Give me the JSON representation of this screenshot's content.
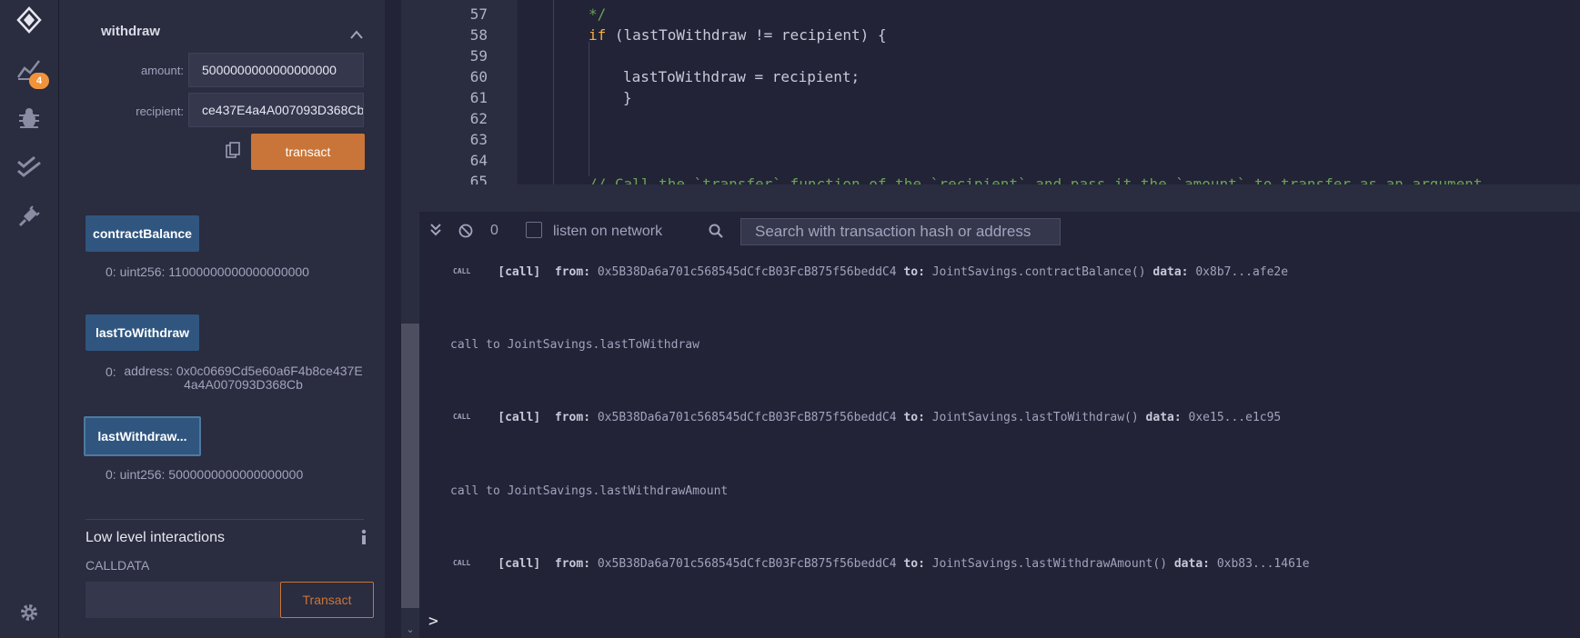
{
  "rail": {
    "badge_count": "4",
    "icons": [
      "remix-logo-icon",
      "deploy-run-icon",
      "debugger-icon",
      "test-check-icon",
      "plugin-icon",
      "settings-gear-icon"
    ]
  },
  "panel": {
    "section_title": "withdraw",
    "amount_label": "amount:",
    "amount_value": "5000000000000000000",
    "recipient_label": "recipient:",
    "recipient_value": "ce437E4a4A007093D368Cb",
    "transact_label": "transact",
    "outputs": [
      {
        "button": "contractBalance",
        "index": "0:",
        "value": "uint256: 11000000000000000000"
      },
      {
        "button": "lastToWithdraw",
        "index": "0:",
        "value_line1": "address: 0x0c0669Cd5e60a6F4b8ce437E",
        "value_line2": "4a4A007093D368Cb"
      },
      {
        "button": "lastWithdraw...",
        "index": "0:",
        "value": "uint256: 5000000000000000000"
      }
    ],
    "low_level_title": "Low level interactions",
    "calldata_label": "CALLDATA",
    "low_level_transact": "Transact"
  },
  "editor": {
    "lines": [
      {
        "num": "57",
        "text": "*/"
      },
      {
        "num": "58",
        "kw": "if",
        "text": " (lastToWithdraw != recipient) {"
      },
      {
        "num": "59",
        "text": ""
      },
      {
        "num": "60",
        "text": "lastToWithdraw = recipient;"
      },
      {
        "num": "61",
        "text": "}"
      },
      {
        "num": "62",
        "text": ""
      },
      {
        "num": "63",
        "text": ""
      },
      {
        "num": "64",
        "text": ""
      },
      {
        "num": "65",
        "text": "// Call the `transfer` function of the `recipient` and pass it the `amount` to transfer as an argument"
      }
    ]
  },
  "terminal": {
    "pending_count": "0",
    "listen_label": "listen on network",
    "search_placeholder": "Search with transaction hash or address",
    "call_badge": "CALL",
    "logs": [
      {
        "type": "call",
        "tag": "[call]",
        "from_label": "from:",
        "from": "0x5B38Da6a701c568545dCfcB03FcB875f56beddC4",
        "to_label": "to:",
        "to": "JointSavings.contractBalance()",
        "data_label": "data:",
        "data": "0x8b7...afe2e"
      },
      {
        "type": "plain",
        "text": "call to JointSavings.lastToWithdraw"
      },
      {
        "type": "call",
        "tag": "[call]",
        "from_label": "from:",
        "from": "0x5B38Da6a701c568545dCfcB03FcB875f56beddC4",
        "to_label": "to:",
        "to": "JointSavings.lastToWithdraw()",
        "data_label": "data:",
        "data": "0xe15...e1c95"
      },
      {
        "type": "plain",
        "text": "call to JointSavings.lastWithdrawAmount"
      },
      {
        "type": "call",
        "tag": "[call]",
        "from_label": "from:",
        "from": "0x5B38Da6a701c568545dCfcB03FcB875f56beddC4",
        "to_label": "to:",
        "to": "JointSavings.lastWithdrawAmount()",
        "data_label": "data:",
        "data": "0xb83...1461e"
      }
    ],
    "prompt": ">"
  },
  "colors": {
    "accent_orange": "#c97539",
    "button_blue": "#305680",
    "keyword": "#f5ad3d",
    "comment": "#6aa353",
    "badge": "#f0933b"
  }
}
